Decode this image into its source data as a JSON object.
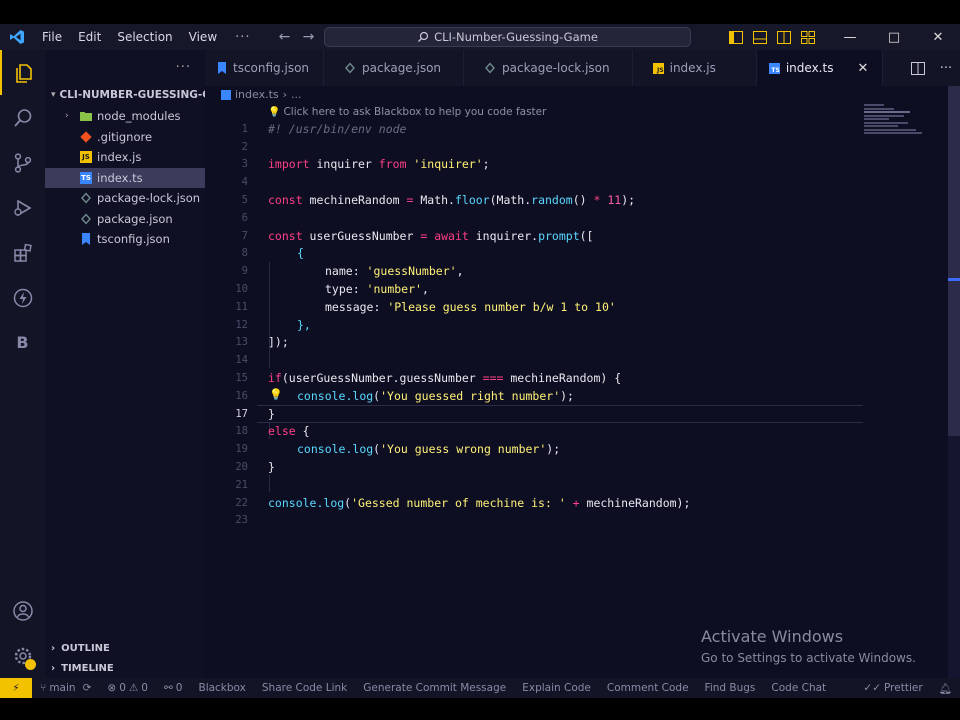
{
  "menu": [
    "File",
    "Edit",
    "Selection",
    "View"
  ],
  "more_label": "···",
  "search": {
    "text": "CLI-Number-Guessing-Game"
  },
  "window": {
    "minimize": "—",
    "maximize": "□",
    "close": "✕"
  },
  "explorer": {
    "more": "···",
    "root": "CLI-NUMBER-GUESSING-G...",
    "items": [
      {
        "name": "node_modules",
        "type": "folder"
      },
      {
        "name": ".gitignore",
        "type": "git"
      },
      {
        "name": "index.js",
        "type": "js"
      },
      {
        "name": "index.ts",
        "type": "ts"
      },
      {
        "name": "package-lock.json",
        "type": "json"
      },
      {
        "name": "package.json",
        "type": "json"
      },
      {
        "name": "tsconfig.json",
        "type": "tsconfig"
      }
    ],
    "outline": "OUTLINE",
    "timeline": "TIMELINE"
  },
  "tabs": [
    {
      "label": "tsconfig.json",
      "icon": "tsconfig"
    },
    {
      "label": "package.json",
      "icon": "json"
    },
    {
      "label": "package-lock.json",
      "icon": "json"
    },
    {
      "label": "index.js",
      "icon": "js"
    },
    {
      "label": "index.ts",
      "icon": "ts"
    }
  ],
  "breadcrumb": {
    "file": "index.ts",
    "sep": "›",
    "rest": "..."
  },
  "hint": "Click here to ask Blackbox to help you code faster",
  "line_numbers": [
    "1",
    "2",
    "3",
    "4",
    "5",
    "6",
    "7",
    "8",
    "9",
    "10",
    "11",
    "12",
    "13",
    "14",
    "15",
    "16",
    "17",
    "18",
    "19",
    "20",
    "21",
    "22",
    "23"
  ],
  "code": {
    "l1": "#! /usr/bin/env node",
    "l3a": "import",
    "l3b": " inquirer ",
    "l3c": "from",
    "l3d": " 'inquirer'",
    "l3e": ";",
    "l5a": "const",
    "l5b": " mechineRandom ",
    "l5c": "=",
    "l5d": " Math.",
    "l5e": "floor",
    "l5f": "(Math.",
    "l5g": "random",
    "l5h": "() ",
    "l5i": "*",
    "l5j": " 11",
    "l5k": ");",
    "l7a": "const",
    "l7b": " userGuessNumber ",
    "l7c": "=",
    "l7d": " ",
    "l7e": "await",
    "l7f": " inquirer.",
    "l7g": "prompt",
    "l7h": "([",
    "l8": "{",
    "l9a": "name: ",
    "l9b": "'guessNumber'",
    "l9c": ",",
    "l10a": "type: ",
    "l10b": "'number'",
    "l10c": ",",
    "l11a": "message: ",
    "l11b": "'Please guess number b/w 1 to 10'",
    "l12": "},",
    "l13": "]);",
    "l15a": "if",
    "l15b": "(userGuessNumber.guessNumber ",
    "l15c": "===",
    "l15d": " mechineRandom) {",
    "l16a": "console.",
    "l16b": "log",
    "l16c": "(",
    "l16d": "'You guessed right number'",
    "l16e": ");",
    "l17": "}",
    "l18a": "else",
    "l18b": " {",
    "l19a": "console.",
    "l19b": "log",
    "l19c": "(",
    "l19d": "'You guess wrong number'",
    "l19e": ");",
    "l20": "}",
    "l22a": "console.",
    "l22b": "log",
    "l22c": "(",
    "l22d": "'Gessed number of mechine is: '",
    "l22e": " + ",
    "l22f": "mechineRandom);"
  },
  "watermark": {
    "title": "Activate Windows",
    "subtitle": "Go to Settings to activate Windows."
  },
  "status": {
    "branch": "main",
    "errors": "0",
    "warnings": "0",
    "ports": "0",
    "blackbox": "Blackbox",
    "share": "Share Code Link",
    "commit": "Generate Commit Message",
    "explain": "Explain Code",
    "comment": "Comment Code",
    "bugs": "Find Bugs",
    "chat": "Code Chat",
    "prettier": "Prettier"
  },
  "colors": {
    "accent": "#f2c200",
    "keyword": "#ff3f86",
    "string": "#fff176",
    "function": "#59d8ff"
  }
}
